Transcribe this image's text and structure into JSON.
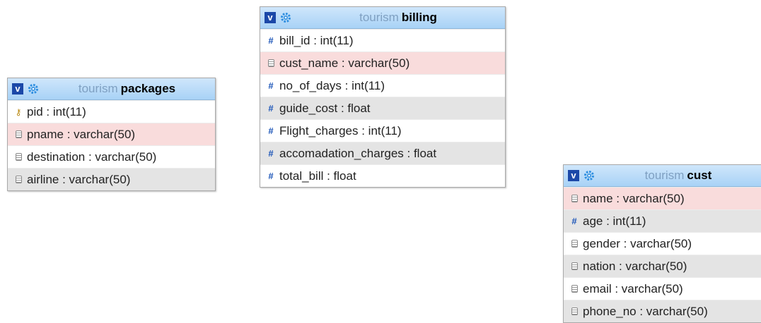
{
  "tables": {
    "packages": {
      "db": "tourism",
      "name": "packages",
      "columns": [
        {
          "icon": "key-icon",
          "text": "pid : int(11)",
          "shade": 0
        },
        {
          "icon": "column-icon",
          "text": "pname : varchar(50)",
          "shade": 1
        },
        {
          "icon": "column-icon",
          "text": "destination : varchar(50)",
          "shade": 0
        },
        {
          "icon": "column-icon",
          "text": "airline : varchar(50)",
          "shade": 2
        }
      ]
    },
    "billing": {
      "db": "tourism",
      "name": "billing",
      "columns": [
        {
          "icon": "numeric-icon",
          "text": "bill_id : int(11)",
          "shade": 0
        },
        {
          "icon": "column-icon",
          "text": "cust_name : varchar(50)",
          "shade": 1
        },
        {
          "icon": "numeric-icon",
          "text": "no_of_days : int(11)",
          "shade": 0
        },
        {
          "icon": "numeric-icon",
          "text": "guide_cost : float",
          "shade": 2
        },
        {
          "icon": "numeric-icon",
          "text": "Flight_charges : int(11)",
          "shade": 0
        },
        {
          "icon": "numeric-icon",
          "text": "accomadation_charges : float",
          "shade": 2
        },
        {
          "icon": "numeric-icon",
          "text": "total_bill : float",
          "shade": 0
        }
      ]
    },
    "cust": {
      "db": "tourism",
      "name": "cust",
      "columns": [
        {
          "icon": "column-icon",
          "text": "name : varchar(50)",
          "shade": 1
        },
        {
          "icon": "numeric-icon",
          "text": "age : int(11)",
          "shade": 2
        },
        {
          "icon": "column-icon",
          "text": "gender : varchar(50)",
          "shade": 0
        },
        {
          "icon": "column-icon",
          "text": "nation : varchar(50)",
          "shade": 2
        },
        {
          "icon": "column-icon",
          "text": "email : varchar(50)",
          "shade": 0
        },
        {
          "icon": "column-icon",
          "text": "phone_no : varchar(50)",
          "shade": 2
        }
      ]
    }
  },
  "header": {
    "toggle_label": "v"
  },
  "colors": {
    "header_bg": "#a8d2f6",
    "toggle_bg": "#1b48a8",
    "db_text": "#7fa0c2",
    "row_pink": "#f9dcdc",
    "row_gray": "#e4e4e4",
    "numeric_icon": "#1c55b8"
  }
}
